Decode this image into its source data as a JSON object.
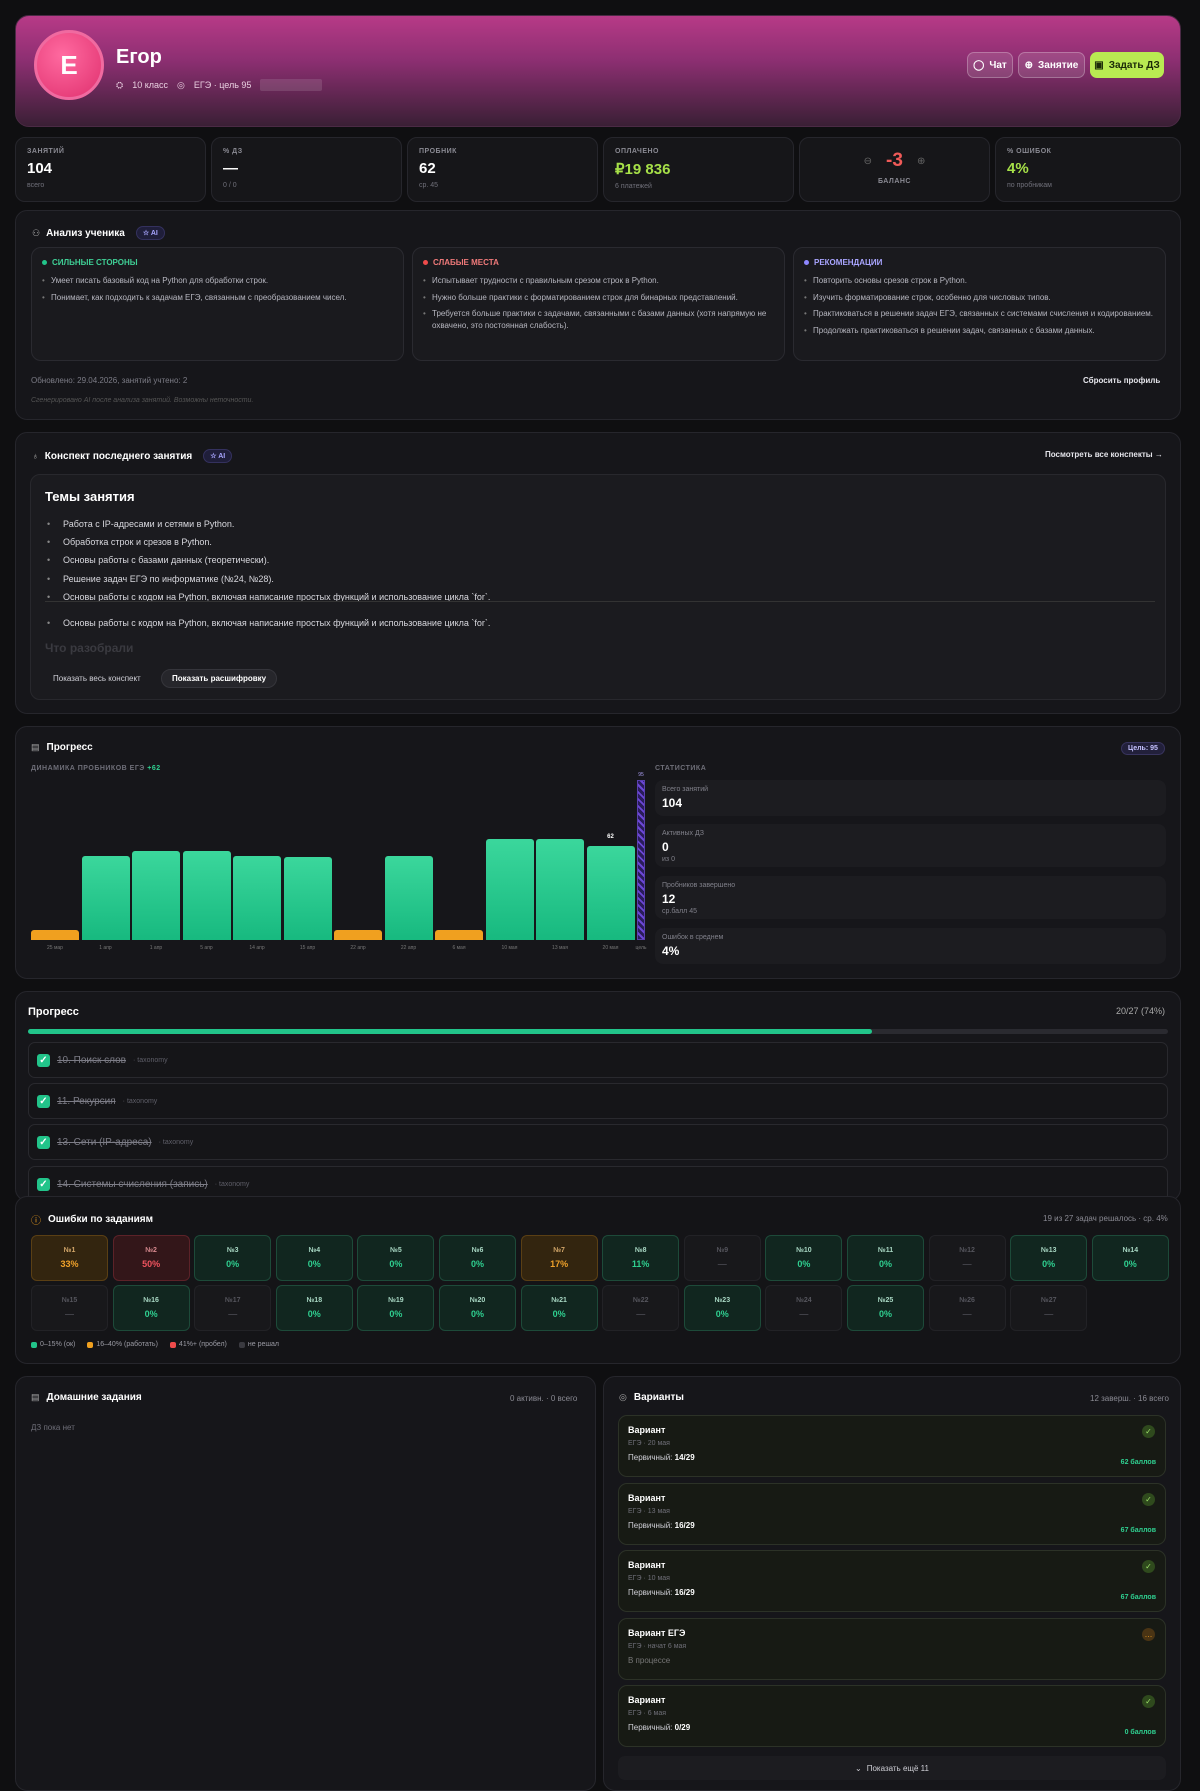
{
  "header": {
    "avatar_letter": "Е",
    "name": "Егор",
    "grade": "10 класс",
    "exam_goal": "ЕГЭ · цель 95",
    "chat_label": "Чат",
    "lesson_label": "Занятие",
    "assign_label": "Задать ДЗ"
  },
  "stats": {
    "lessons": {
      "label": "ЗАНЯТИЙ",
      "value": "104",
      "sub": "всего"
    },
    "homework": {
      "label": "% ДЗ",
      "value": "—",
      "sub": "0 / 0"
    },
    "mock": {
      "label": "ПРОБНИК",
      "value": "62",
      "sub": "ср. 45"
    },
    "paid": {
      "label": "ОПЛАЧЕНО",
      "value": "₽19 836",
      "sub": "6 платежей"
    },
    "balance": {
      "value": "-3",
      "label": "БАЛАНС"
    },
    "errors": {
      "label": "% ОШИБОК",
      "value": "4%",
      "sub": "по пробникам"
    }
  },
  "analysis": {
    "title": "Анализ ученика",
    "badge": "AI",
    "strong": {
      "title": "СИЛЬНЫЕ СТОРОНЫ",
      "items": [
        "Умеет писать базовый код на Python для обработки строк.",
        "Понимает, как подходить к задачам ЕГЭ, связанным с преобразованием чисел."
      ]
    },
    "weak": {
      "title": "СЛАБЫЕ МЕСТА",
      "items": [
        "Испытывает трудности с правильным срезом строк в Python.",
        "Нужно больше практики с форматированием строк для бинарных представлений.",
        "Требуется больше практики с задачами, связанными с базами данных (хотя напрямую не охвачено, это постоянная слабость)."
      ]
    },
    "recs": {
      "title": "РЕКОМЕНДАЦИИ",
      "items": [
        "Повторить основы срезов строк в Python.",
        "Изучить форматирование строк, особенно для числовых типов.",
        "Практиковаться в решении задач ЕГЭ, связанных с системами счисления и кодированием.",
        "Продолжать практиковаться в решении задач, связанных с базами данных."
      ]
    },
    "updated": "Обновлено: 29.04.2026, занятий учтено: 2",
    "reset": "Сбросить профиль",
    "disclaimer": "Сгенерировано AI после анализа занятий. Возможны неточности."
  },
  "summary": {
    "title": "Конспект последнего занятия",
    "badge": "AI",
    "view_all": "Посмотреть все конспекты →",
    "topics_title": "Темы занятия",
    "topics": [
      "Работа с IP-адресами и сетями в Python.",
      "Обработка строк и срезов в Python.",
      "Основы работы с базами данных (теоретически).",
      "Решение задач ЕГЭ по информатике (№24, №28).",
      "Основы работы с кодом на Python, включая написание простых функций и использование цикла `for`.",
      "Основы работы с кодом на Python, включая написание простых функций и использование цикла `for`."
    ],
    "faded": "Что разобрали",
    "show_full": "Показать весь конспект",
    "show_transcript": "Показать расшифровку"
  },
  "progress": {
    "title": "Прогресс",
    "goal_badge": "Цель: 95",
    "chart_label": "ДИНАМИКА ПРОБНИКОВ ЕГЭ",
    "delta": "+62",
    "stats_title": "СТАТИСТИКА",
    "stat_boxes": [
      {
        "label": "Всего занятий",
        "value": "104",
        "sub": ""
      },
      {
        "label": "Активных ДЗ",
        "value": "0",
        "sub": "из 0"
      },
      {
        "label": "Пробников завершено",
        "value": "12",
        "sub": "ср.балл 45"
      },
      {
        "label": "Ошибок в среднем",
        "value": "4%",
        "sub": ""
      }
    ]
  },
  "chart_data": {
    "type": "bar",
    "categories": [
      "25 мар",
      "1 апр",
      "1 апр",
      "5 апр",
      "14 апр",
      "15 апр",
      "22 апр",
      "22 апр",
      "6 мая",
      "10 мая",
      "13 мая",
      "20 мая"
    ],
    "values": [
      5,
      50,
      53,
      53,
      50,
      49,
      5,
      50,
      5,
      60,
      60,
      56
    ],
    "last_label": "62",
    "goal_label": "95",
    "goal_tick": "цель",
    "ylim": [
      0,
      95
    ]
  },
  "tasks_progress": {
    "title": "Прогресс",
    "count": "20/27 (74%)",
    "fraction": 0.74,
    "items": [
      {
        "title": "10. Поиск слов",
        "tag": "· taxonomy"
      },
      {
        "title": "11. Рекурсия",
        "tag": "· taxonomy"
      },
      {
        "title": "13. Сети (IP-адреса)",
        "tag": "· taxonomy"
      },
      {
        "title": "14. Системы счисления (запись)",
        "tag": "· taxonomy"
      }
    ]
  },
  "errors": {
    "title": "Ошибки по заданиям",
    "summary": "19 из 27 задач решалось · ср. 4%",
    "cells": [
      {
        "n": "№1",
        "p": "33%",
        "s": "warn"
      },
      {
        "n": "№2",
        "p": "50%",
        "s": "bad"
      },
      {
        "n": "№3",
        "p": "0%",
        "s": "ok"
      },
      {
        "n": "№4",
        "p": "0%",
        "s": "ok"
      },
      {
        "n": "№5",
        "p": "0%",
        "s": "ok"
      },
      {
        "n": "№6",
        "p": "0%",
        "s": "ok"
      },
      {
        "n": "№7",
        "p": "17%",
        "s": "warn"
      },
      {
        "n": "№8",
        "p": "11%",
        "s": "ok"
      },
      {
        "n": "№9",
        "p": "—",
        "s": "none"
      },
      {
        "n": "№10",
        "p": "0%",
        "s": "ok"
      },
      {
        "n": "№11",
        "p": "0%",
        "s": "ok"
      },
      {
        "n": "№12",
        "p": "—",
        "s": "none"
      },
      {
        "n": "№13",
        "p": "0%",
        "s": "ok"
      },
      {
        "n": "№14",
        "p": "0%",
        "s": "ok"
      },
      {
        "n": "№15",
        "p": "—",
        "s": "none"
      },
      {
        "n": "№16",
        "p": "0%",
        "s": "ok"
      },
      {
        "n": "№17",
        "p": "—",
        "s": "none"
      },
      {
        "n": "№18",
        "p": "0%",
        "s": "ok"
      },
      {
        "n": "№19",
        "p": "0%",
        "s": "ok"
      },
      {
        "n": "№20",
        "p": "0%",
        "s": "ok"
      },
      {
        "n": "№21",
        "p": "0%",
        "s": "ok"
      },
      {
        "n": "№22",
        "p": "—",
        "s": "none"
      },
      {
        "n": "№23",
        "p": "0%",
        "s": "ok"
      },
      {
        "n": "№24",
        "p": "—",
        "s": "none"
      },
      {
        "n": "№25",
        "p": "0%",
        "s": "ok"
      },
      {
        "n": "№26",
        "p": "—",
        "s": "none"
      },
      {
        "n": "№27",
        "p": "—",
        "s": "none"
      }
    ],
    "legend": [
      "0–15% (ок)",
      "16–40% (работать)",
      "41%+ (пробел)",
      "не решал"
    ]
  },
  "homework": {
    "title": "Домашние задания",
    "count": "0 активн. · 0 всего",
    "empty": "ДЗ пока нет"
  },
  "variants": {
    "title": "Варианты",
    "count": "12 заверш. · 16 всего",
    "items": [
      {
        "title": "Вариант",
        "sub": "ЕГЭ · 20 мая",
        "primary_label": "Первичный:",
        "primary": "14/29",
        "score": "62 баллов",
        "done": true
      },
      {
        "title": "Вариант",
        "sub": "ЕГЭ · 13 мая",
        "primary_label": "Первичный:",
        "primary": "16/29",
        "score": "67 баллов",
        "done": true
      },
      {
        "title": "Вариант",
        "sub": "ЕГЭ · 10 мая",
        "primary_label": "Первичный:",
        "primary": "16/29",
        "score": "67 баллов",
        "done": true
      },
      {
        "title": "Вариант ЕГЭ",
        "sub": "ЕГЭ · начат 6 мая",
        "primary_label": "В процессе",
        "primary": "",
        "score": "",
        "done": false
      },
      {
        "title": "Вариант",
        "sub": "ЕГЭ · 6 мая",
        "primary_label": "Первичный:",
        "primary": "0/29",
        "score": "0 баллов",
        "done": true
      }
    ],
    "more": "Показать ещё 11"
  },
  "colors": {
    "accent": "#22c48a",
    "warn": "#f0a01f",
    "bad": "#f0535e",
    "brand": "#b73a87",
    "lime": "#c9f25a"
  }
}
